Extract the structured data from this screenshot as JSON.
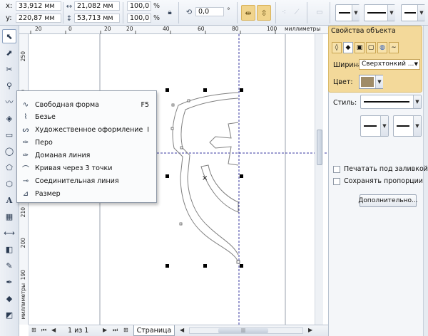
{
  "propbar": {
    "x_label": "x:",
    "x_value": "33,912 мм",
    "y_label": "y:",
    "y_value": "220,87 мм",
    "w_value": "21,082 мм",
    "h_value": "53,713 мм",
    "scale_x": "100,0",
    "scale_y": "100,0",
    "percent": "%",
    "rotation": "0,0",
    "rotation_unit": "°"
  },
  "ruler": {
    "unit_label": "миллиметры",
    "top_ticks": [
      "20",
      "0",
      "20",
      "20",
      "40",
      "60",
      "80",
      "100",
      "120"
    ],
    "left_ticks": [
      "250",
      "240",
      "230",
      "220",
      "210",
      "200",
      "190"
    ],
    "left_unit": "миллиметры"
  },
  "flyout": {
    "items": [
      {
        "icon": "freehand-icon",
        "label": "Свободная форма",
        "shortcut": "F5"
      },
      {
        "icon": "bezier-icon",
        "label": "Безье",
        "shortcut": ""
      },
      {
        "icon": "artistic-media-icon",
        "label": "Художественное оформление",
        "shortcut": "I"
      },
      {
        "icon": "pen-icon",
        "label": "Перо",
        "shortcut": ""
      },
      {
        "icon": "polyline-icon",
        "label": "Доманая линия",
        "shortcut": ""
      },
      {
        "icon": "three-point-curve-icon",
        "label": "Кривая через 3 точки",
        "shortcut": ""
      },
      {
        "icon": "connector-icon",
        "label": "Соединительная линия",
        "shortcut": ""
      },
      {
        "icon": "dimension-icon",
        "label": "Размер",
        "shortcut": ""
      }
    ]
  },
  "docker": {
    "title": "Свойства объекта",
    "width_label": "Ширина:",
    "width_value": "Сверхтонкий ...",
    "color_label": "Цвет:",
    "color_value": "#a08c68",
    "style_label": "Стиль:",
    "print_behind_fill": "Печатать под заливкой",
    "keep_proportions": "Сохранять пропорции",
    "more_button": "Дополнительно..."
  },
  "pagebar": {
    "page_counter": "1 из 1",
    "page_tab": "Страница"
  },
  "colors": {
    "highlight": "#f1d48c",
    "outline_color": "#a08c68",
    "guide": "#3a3aa0"
  }
}
